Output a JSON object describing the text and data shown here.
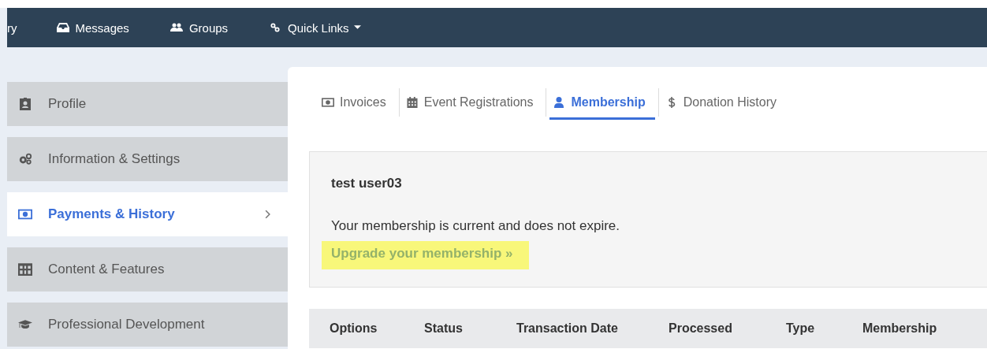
{
  "navbar": {
    "items": [
      {
        "label": "ry",
        "kind": "none"
      },
      {
        "label": "Messages",
        "kind": "inbox"
      },
      {
        "label": "Groups",
        "kind": "users"
      },
      {
        "label": "Quick Links",
        "kind": "link",
        "dropdown": true
      }
    ]
  },
  "sidebar": {
    "items": [
      {
        "label": "Profile",
        "kind": "badge",
        "selected": false
      },
      {
        "label": "Information & Settings",
        "kind": "gears",
        "selected": false
      },
      {
        "label": "Payments & History",
        "kind": "money",
        "selected": true
      },
      {
        "label": "Content & Features",
        "kind": "table",
        "selected": false
      },
      {
        "label": "Professional Development",
        "kind": "cap",
        "selected": false
      }
    ]
  },
  "tabs": [
    {
      "label": "Invoices",
      "kind": "money",
      "selected": false
    },
    {
      "label": "Event Registrations",
      "kind": "calendar",
      "selected": false
    },
    {
      "label": "Membership",
      "kind": "user",
      "selected": true
    },
    {
      "label": "Donation History",
      "kind": "dollar",
      "selected": false
    }
  ],
  "membership": {
    "name": "test user03",
    "message": "Your membership is current and does not expire.",
    "upgrade_link": "Upgrade your membership »",
    "highlighted": true
  },
  "table": {
    "columns": [
      "Options",
      "Status",
      "Transaction Date",
      "Processed",
      "Type",
      "Membership"
    ]
  }
}
